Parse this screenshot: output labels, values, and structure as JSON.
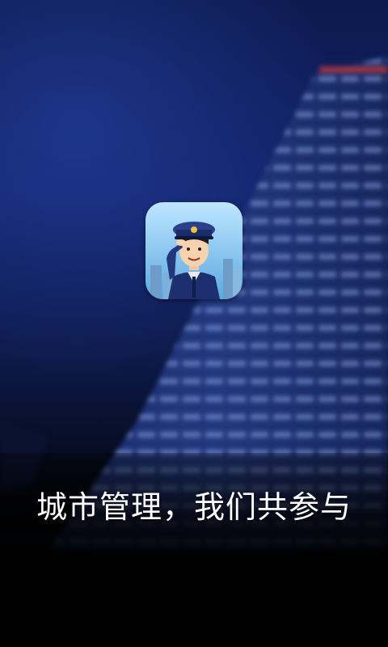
{
  "splash": {
    "app_icon": {
      "icon": "saluting-officer-icon",
      "background_color": "#7fc3ee"
    },
    "tagline": "城市管理，我们共参与"
  },
  "colors": {
    "sky_top": "#0d1a4f",
    "sky_mid": "#12236a",
    "ground": "#000000",
    "text": "#ffffff"
  }
}
